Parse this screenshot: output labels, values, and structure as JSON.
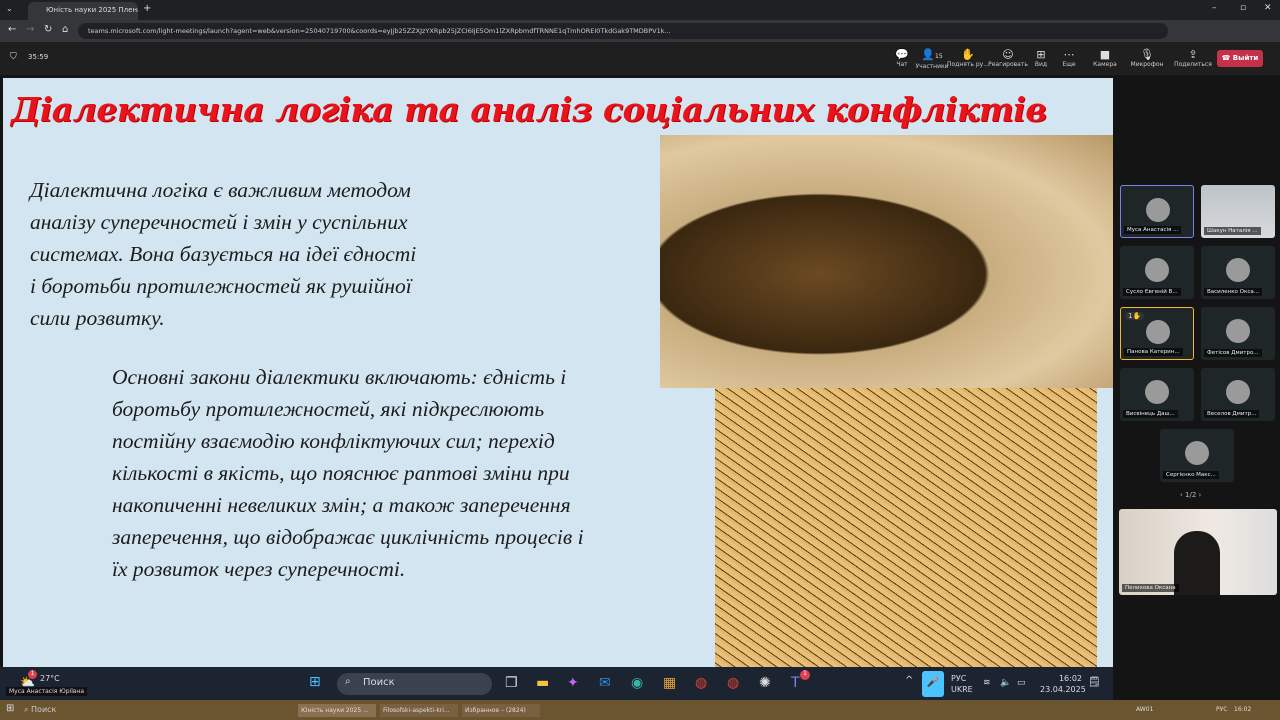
{
  "browser": {
    "tab_title": "Юність науки 2025 Пленар",
    "url": "teams.microsoft.com/light-meetings/launch?agent=web&version=25040719700&coords=eyJjb25ZZXJzYXRpb25JZCI6IjE5Om1lZXRpbmdfTRNNE1qTmhOREI0TkdGak9TMDBPV1k..."
  },
  "meeting": {
    "timer": "35:59",
    "toolbar": [
      {
        "icon": "chat-icon",
        "label": "Чат"
      },
      {
        "icon": "people-icon",
        "label": "Участники",
        "badge": "15"
      },
      {
        "icon": "raise-hand-icon",
        "label": "Поднять ру..."
      },
      {
        "icon": "react-icon",
        "label": "Реагировать"
      },
      {
        "icon": "view-icon",
        "label": "Вид"
      },
      {
        "icon": "more-icon",
        "label": "Еще"
      },
      {
        "icon": "camera-icon",
        "label": "Камера"
      },
      {
        "icon": "mic-off-icon",
        "label": "Микрофон"
      },
      {
        "icon": "share-icon",
        "label": "Поделиться"
      }
    ],
    "leave": "Выйти"
  },
  "slide": {
    "title": "Діалектична логіка та аналіз соціальних конфліктів",
    "paragraph1": [
      "Діалектична логіка є важливим методом",
      "аналізу суперечностей і змін у суспільних",
      "системах. Вона базується на ідеї єдності",
      "і боротьби протилежностей як рушійної",
      "сили розвитку."
    ],
    "paragraph2": [
      "Основні закони діалектики включають: єдність і",
      "боротьбу протилежностей, які підкреслюють",
      "постійну взаємодію конфліктуючих сил; перехід",
      "кількості в якість, що пояснює раптові зміни при",
      "накопиченні невеликих змін; а також заперечення",
      "заперечення, що відображає циклічність процесів і",
      "їх розвиток через суперечності."
    ]
  },
  "participants": [
    {
      "name": "Муса Анастасія ...",
      "state": "speaking"
    },
    {
      "name": "Шакун Наталія ...",
      "state": "video"
    },
    {
      "name": "Сусло Євгеній В...",
      "state": "muted"
    },
    {
      "name": "Василенко Окса...",
      "state": "muted"
    },
    {
      "name": "Панова Катерин...",
      "state": "hand-raised",
      "hand": "1"
    },
    {
      "name": "Фетісов Дмитро...",
      "state": "muted"
    },
    {
      "name": "Висвінець Даш...",
      "state": "muted"
    },
    {
      "name": "Веселов Дмитр...",
      "state": "muted"
    },
    {
      "name": "Сергієнко Макс...",
      "state": "muted"
    }
  ],
  "pager": "1/2",
  "self_video": {
    "name": "Пелихова Оксана"
  },
  "taskbar": {
    "weather": "27°C",
    "weather_badge": "1",
    "overlay_name": "Муса Анастасія Юріївна",
    "search": "Поиск",
    "teams_badge": "1",
    "lang1": "РУС",
    "lang2": "UKRE",
    "time": "16:02",
    "date": "23.04.2025"
  },
  "host_taskbar": {
    "search": "Поиск",
    "items": [
      "Юність науки 2025 ...",
      "Filosofski-aspekti-kri...",
      "Избранное – (2824)"
    ],
    "tray_app": "AW01",
    "lang": "РУС",
    "time": "16:02"
  }
}
